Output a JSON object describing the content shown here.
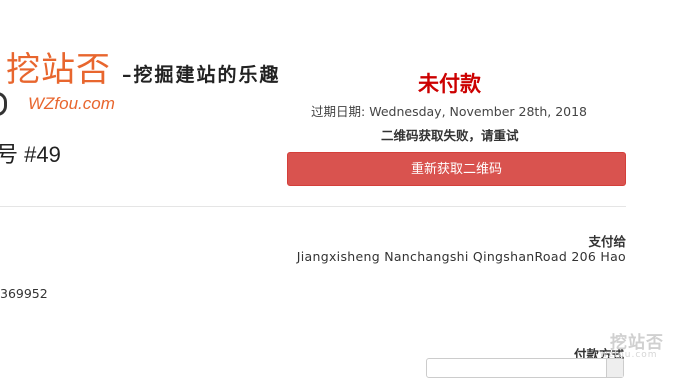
{
  "logo": {
    "cn_title": "挖站否",
    "slogan": "–挖掘建站的乐趣",
    "en_title": "WZfou.com"
  },
  "invoice": {
    "number_text": "号 #49",
    "status": "未付款",
    "due_label": "过期日期:",
    "due_date": "Wednesday, November 28th, 2018",
    "qr_error": "二维码获取失败，请重试",
    "retry_button": "重新获取二维码",
    "pay_to_label": "支付给",
    "pay_to_address": "Jiangxisheng Nanchangshi QingshanRoad 206 Hao",
    "left_number": "369952",
    "payment_method_label": "付款方式"
  },
  "watermark": {
    "text": "挖站否",
    "sub": "wzfou.com"
  },
  "colors": {
    "accent": "#e8662e",
    "status": "#cc0000",
    "button": "#d9534f"
  }
}
